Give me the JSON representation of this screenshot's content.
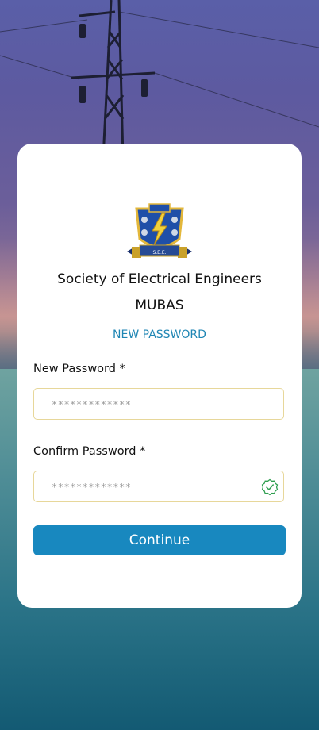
{
  "header": {
    "org_name": "Society of Electrical Engineers",
    "org_short": "MUBAS",
    "screen_title": "NEW PASSWORD"
  },
  "logo": {
    "ribbon_text": "S.E.E."
  },
  "form": {
    "new_password": {
      "label": "New Password *",
      "value": "*************"
    },
    "confirm_password": {
      "label": "Confirm Password *",
      "value": "*************",
      "status_icon": "check-circle-icon"
    },
    "continue_label": "Continue"
  },
  "colors": {
    "accent": "#1888bf",
    "subtitle": "#1f86b4",
    "field_border": "#e7d79a",
    "check_green": "#2e9e4f"
  }
}
